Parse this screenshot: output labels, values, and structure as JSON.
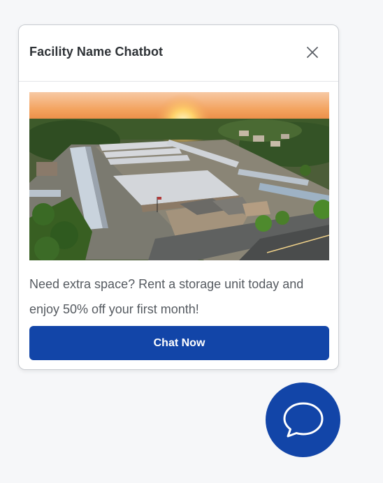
{
  "widget": {
    "title": "Facility Name Chatbot",
    "close_icon": "close-icon",
    "image_alt": "Aerial view of storage facility at sunset",
    "promo_text": "Need extra space? Rent a storage unit today and enjoy 50% off your first month!",
    "cta_label": "Chat Now"
  },
  "launcher": {
    "icon": "chat-bubble-icon"
  },
  "colors": {
    "brand": "#1245a8",
    "background": "#f6f7f9",
    "card": "#ffffff",
    "title_text": "#2f3337",
    "body_text": "#555a60"
  }
}
